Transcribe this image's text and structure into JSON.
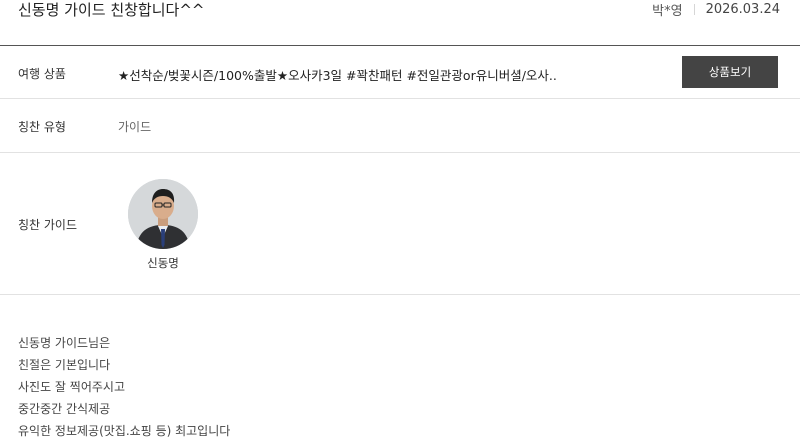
{
  "post": {
    "title": "신동명 가이드 친창합니다^^",
    "author": "박*영",
    "date": "2026.03.24"
  },
  "product": {
    "label": "여행 상품",
    "value": "★선착순/벚꽃시즌/100%출발★오사카3일 #꽉찬패턴 #전일관광or유니버셜/오사...",
    "button_label": "상품보기"
  },
  "praise_type": {
    "label": "칭찬 유형",
    "value": "가이드"
  },
  "praise_guide": {
    "label": "칭찬 가이드",
    "guide_name": "신동명"
  },
  "body": {
    "lines": [
      "신동명 가이드님은",
      "친절은 기본입니다",
      "사진도 잘 찍어주시고",
      "중간중간 간식제공",
      "유익한 정보제공(맛집.쇼핑 등) 최고입니다"
    ]
  }
}
